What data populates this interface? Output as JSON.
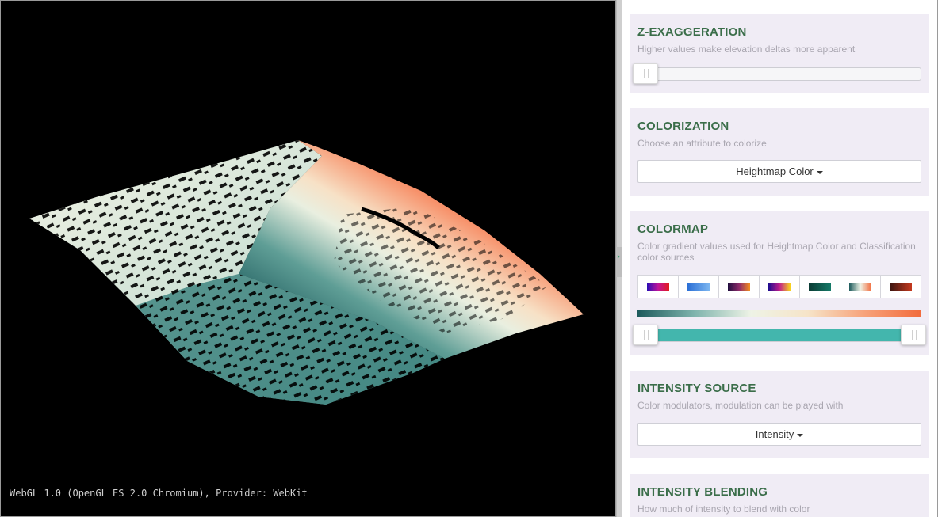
{
  "viewport": {
    "renderer_info": "WebGL 1.0 (OpenGL ES 2.0 Chromium), Provider: WebKit"
  },
  "panel": {
    "z_exaggeration": {
      "title": "Z-EXAGGERATION",
      "description": "Higher values make elevation deltas more apparent",
      "value": 0.0
    },
    "colorization": {
      "title": "COLORIZATION",
      "description": "Choose an attribute to colorize",
      "selected": "Heightmap Color"
    },
    "colormap": {
      "title": "COLORMAP",
      "description": "Color gradient values used for Heightmap Color and Classification color sources",
      "swatches": [
        {
          "name": "blue-red-colormap",
          "colors": [
            "#2a0db5",
            "#c0149a",
            "#e21b1b"
          ]
        },
        {
          "name": "blues-colormap",
          "colors": [
            "#2b6fd6",
            "#7cb6f0"
          ]
        },
        {
          "name": "magma-colormap",
          "colors": [
            "#1e0e3d",
            "#8d2a6a",
            "#f28c1f"
          ]
        },
        {
          "name": "plasma-colormap",
          "colors": [
            "#1a0b8f",
            "#c01d8c",
            "#f9d71c"
          ]
        },
        {
          "name": "teal-colormap",
          "colors": [
            "#0b3b34",
            "#157a68"
          ]
        },
        {
          "name": "teal-orange-colormap",
          "colors": [
            "#1d5a5c",
            "#eef3e6",
            "#f26b3c"
          ]
        },
        {
          "name": "dark-red-colormap",
          "colors": [
            "#3a1410",
            "#c4391e"
          ]
        }
      ],
      "range_min": 0.0,
      "range_max": 1.0,
      "accent_color": "#43b6ad"
    },
    "intensity_source": {
      "title": "INTENSITY SOURCE",
      "description": "Color modulators, modulation can be played with",
      "selected": "Intensity"
    },
    "intensity_blending": {
      "title": "INTENSITY BLENDING",
      "description": "How much of intensity to blend with color"
    }
  },
  "colors": {
    "heading": "#3b6e4a",
    "card_background": "#f0ecf5",
    "terrain_low": "#1d5a5c",
    "terrain_mid": "#eef3e6",
    "terrain_high": "#f26b3c"
  }
}
